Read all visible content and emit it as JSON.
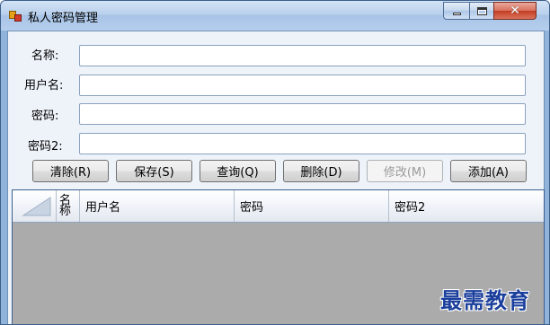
{
  "window": {
    "title": "私人密码管理",
    "controls": {
      "minimize_icon": "minimize-icon",
      "maximize_icon": "maximize-icon",
      "close_glyph": "✕"
    }
  },
  "form": {
    "labels": {
      "name": "名称:",
      "username": "用户名:",
      "password": "密码:",
      "password2": "密码2:"
    },
    "values": {
      "name": "",
      "username": "",
      "password": "",
      "password2": ""
    }
  },
  "buttons": {
    "clear": "清除(R)",
    "save": "保存(S)",
    "query": "查询(Q)",
    "delete": "删除(D)",
    "modify": "修改(M)",
    "add": "添加(A)"
  },
  "grid": {
    "columns": [
      "名称",
      "用户名",
      "密码",
      "密码2"
    ],
    "rows": []
  },
  "watermark": "最需教育",
  "colors": {
    "title_bar": "#b9d0ec",
    "client_bg": "#eef3fa",
    "grid_empty_bg": "#ababab",
    "close_button": "#c33b22",
    "watermark": "#1b3f9c"
  }
}
